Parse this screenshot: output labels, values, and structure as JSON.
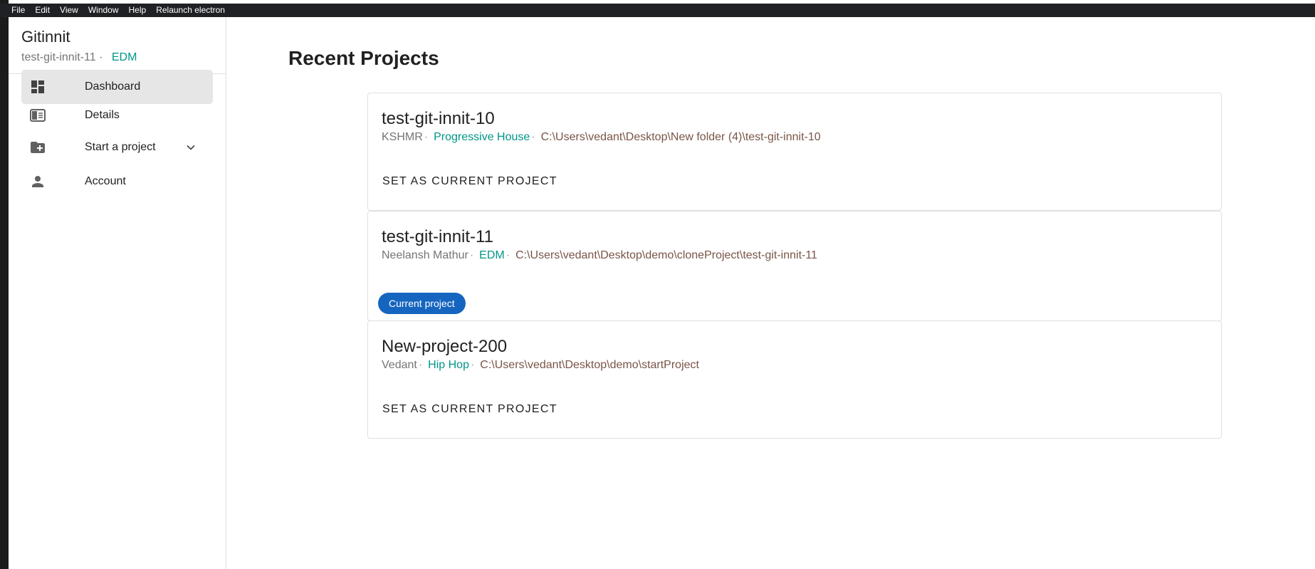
{
  "menubar": {
    "items": [
      "File",
      "Edit",
      "View",
      "Window",
      "Help",
      "Relaunch electron"
    ]
  },
  "sidebar": {
    "app_title": "Gitinnit",
    "current_project": "test-git-innit-11",
    "separator": "·",
    "current_genre": "EDM",
    "items": [
      {
        "label": "Dashboard",
        "icon": "dashboard-icon",
        "active": true
      },
      {
        "label": "Details",
        "icon": "details-icon"
      },
      {
        "label": "Start a project",
        "icon": "folder-add-icon",
        "has_chevron": true
      },
      {
        "label": "Account",
        "icon": "person-icon"
      }
    ]
  },
  "main": {
    "title": "Recent Projects",
    "projects": [
      {
        "name": "test-git-innit-10",
        "author": "KSHMR",
        "genre": "Progressive House",
        "path": "C:\\Users\\vedant\\Desktop\\New folder (4)\\test-git-innit-10",
        "action": "SET AS CURRENT PROJECT"
      },
      {
        "name": "test-git-innit-11",
        "author": "Neelansh Mathur",
        "genre": "EDM",
        "path": "C:\\Users\\vedant\\Desktop\\demo\\cloneProject\\test-git-innit-11",
        "badge": "Current project"
      },
      {
        "name": "New-project-200",
        "author": "Vedant",
        "genre": "Hip Hop",
        "path": "C:\\Users\\vedant\\Desktop\\demo\\startProject",
        "action": "SET AS CURRENT PROJECT"
      }
    ]
  },
  "colors": {
    "accent_genre": "#009688",
    "path": "#795548",
    "badge": "#1565c0",
    "active_nav": "#e6e6e6"
  }
}
